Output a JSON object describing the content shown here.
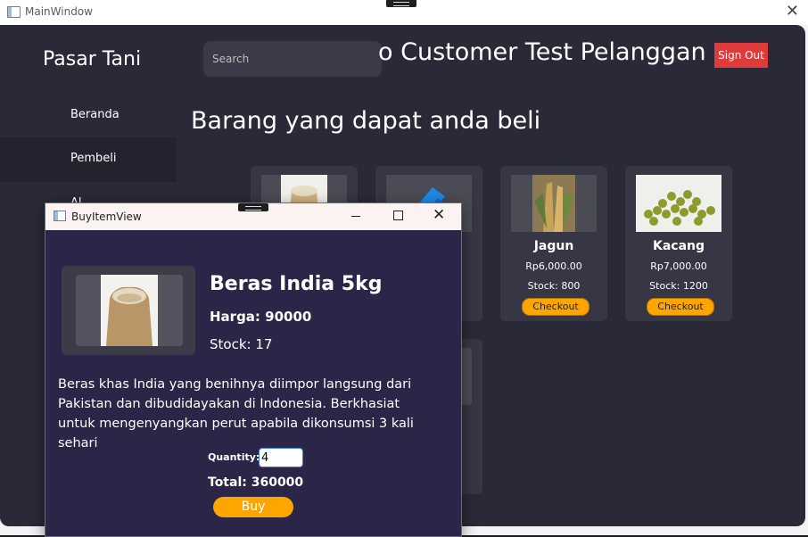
{
  "main_window": {
    "title": "MainWindow",
    "close_glyph": "✕"
  },
  "app": {
    "brand": "Pasar Tani",
    "search_placeholder": "Search",
    "welcome_text": "o Customer Test Pelanggan",
    "sign_out_label": "Sign Out",
    "nav": [
      {
        "label": "Beranda",
        "active": false
      },
      {
        "label": "Pembeli",
        "active": true
      },
      {
        "label": "Al",
        "active": false
      }
    ],
    "section_title": "Barang yang dapat anda beli",
    "products": [
      {
        "name": "",
        "price": "",
        "stock": "",
        "checkout_label": "",
        "image": "rice-sack"
      },
      {
        "name": "",
        "price": "",
        "stock": "",
        "checkout_label": "",
        "image": "blue-logo"
      },
      {
        "name": "Jagun",
        "price": "Rp6,000.00",
        "stock": "Stock: 800",
        "checkout_label": "Checkout",
        "image": "corn"
      },
      {
        "name": "Kacang",
        "price": "Rp7,000.00",
        "stock": "Stock: 1200",
        "checkout_label": "Checkout",
        "image": "peas"
      }
    ]
  },
  "dialog": {
    "title": "BuyItemView",
    "min_glyph": "—",
    "close_glyph": "✕",
    "item_name": "Beras India 5kg",
    "price_text": "Harga: 90000",
    "stock_text": "Stock: 17",
    "description": "Beras khas India yang benihnya diimpor langsung dari Pakistan dan dibudidayakan di Indonesia. Berkhasiat untuk mengenyangkan perut apabila dikonsumsi 3 kali sehari",
    "quantity_label": "Quantity:",
    "quantity_value": "4",
    "total_text": "Total: 360000",
    "buy_label": "Buy"
  },
  "colors": {
    "app_bg": "#2a2937",
    "card_bg": "#363645",
    "dialog_bg": "#2b2648",
    "accent_orange": "#ffa500",
    "sign_out_red": "#df3b3b"
  }
}
